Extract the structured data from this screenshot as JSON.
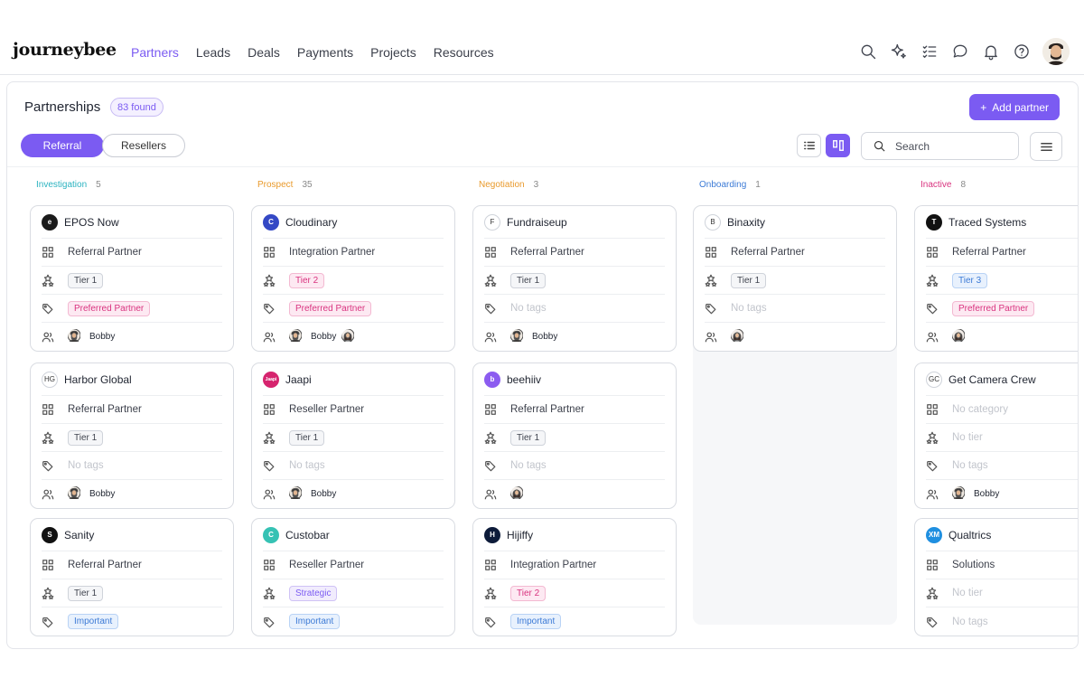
{
  "brand": {
    "name": "journeybee",
    "accent": "#7b5bf2"
  },
  "nav": {
    "items": [
      "Partners",
      "Leads",
      "Deals",
      "Payments",
      "Projects",
      "Resources"
    ],
    "active": "Partners"
  },
  "header": {
    "title": "Partnerships",
    "count_badge": "83 found",
    "add_button": "Add partner"
  },
  "segments": {
    "items": [
      "Referral",
      "Resellers"
    ],
    "active": "Referral"
  },
  "search": {
    "placeholder": "Search"
  },
  "columns": [
    {
      "name": "Investigation",
      "count": "5",
      "color": "#2bb3c0",
      "cards": [
        {
          "name": "EPOS Now",
          "logo": "e",
          "logo_bg": "#1a1a1a",
          "category": "Referral Partner",
          "tier": "Tier 1",
          "tier_style": "tier",
          "tag": "Preferred Partner",
          "tag_style": "pink",
          "people": [
            "Bobby"
          ],
          "extra_face": false
        },
        {
          "name": "Harbor Global",
          "logo": "HG",
          "logo_bg": "#ffffff",
          "category": "Referral Partner",
          "tier": "Tier 1",
          "tier_style": "tier",
          "tag": "No tags",
          "tag_style": "none",
          "people": [
            "Bobby"
          ],
          "extra_face": false
        },
        {
          "name": "Sanity",
          "logo": "S",
          "logo_bg": "#111111",
          "category": "Referral Partner",
          "tier": "Tier 1",
          "tier_style": "tier",
          "tag": "Important",
          "tag_style": "blue",
          "people": [],
          "extra_face": false
        }
      ]
    },
    {
      "name": "Prospect",
      "count": "35",
      "color": "#e99a2c",
      "cards": [
        {
          "name": "Cloudinary",
          "logo": "C",
          "logo_bg": "#3448c5",
          "category": "Integration Partner",
          "tier": "Tier 2",
          "tier_style": "pink",
          "tag": "Preferred Partner",
          "tag_style": "pink",
          "people": [
            "Bobby"
          ],
          "extra_face": true
        },
        {
          "name": "Jaapi",
          "logo": "Jaapi",
          "logo_bg": "#d6246e",
          "category": "Reseller Partner",
          "tier": "Tier 1",
          "tier_style": "tier",
          "tag": "No tags",
          "tag_style": "none",
          "people": [
            "Bobby"
          ],
          "extra_face": false
        },
        {
          "name": "Custobar",
          "logo": "C",
          "logo_bg": "#36c2b4",
          "category": "Reseller Partner",
          "tier": "Strategic",
          "tier_style": "violet",
          "tag": "Important",
          "tag_style": "blue",
          "people": [],
          "extra_face": false
        }
      ]
    },
    {
      "name": "Negotiation",
      "count": "3",
      "color": "#e99a2c",
      "cards": [
        {
          "name": "Fundraiseup",
          "logo": "F",
          "logo_bg": "#ffffff",
          "category": "Referral Partner",
          "tier": "Tier 1",
          "tier_style": "tier",
          "tag": "No tags",
          "tag_style": "none",
          "people": [
            "Bobby"
          ],
          "extra_face": false
        },
        {
          "name": "beehiiv",
          "logo": "b",
          "logo_bg": "#8c5cf0",
          "category": "Referral Partner",
          "tier": "Tier 1",
          "tier_style": "tier",
          "tag": "No tags",
          "tag_style": "none",
          "people": [],
          "extra_face": true
        },
        {
          "name": "Hijiffy",
          "logo": "H",
          "logo_bg": "#0d1b3a",
          "category": "Integration Partner",
          "tier": "Tier 2",
          "tier_style": "pink",
          "tag": "Important",
          "tag_style": "blue",
          "people": [],
          "extra_face": false
        }
      ]
    },
    {
      "name": "Onboarding",
      "count": "1",
      "color": "#3d7bd6",
      "cards": [
        {
          "name": "Binaxity",
          "logo": "B",
          "logo_bg": "#ffffff",
          "category": "Referral Partner",
          "tier": "Tier 1",
          "tier_style": "tier",
          "tag": "No tags",
          "tag_style": "none",
          "people": [],
          "extra_face": true
        }
      ]
    },
    {
      "name": "Inactive",
      "count": "8",
      "color": "#d9337f",
      "cards": [
        {
          "name": "Traced Systems",
          "logo": "T",
          "logo_bg": "#111111",
          "category": "Referral Partner",
          "tier": "Tier 3",
          "tier_style": "blue",
          "tag": "Preferred Partner",
          "tag_style": "pink",
          "people": [],
          "extra_face": true
        },
        {
          "name": "Get Camera Crew",
          "logo": "GC",
          "logo_bg": "#ffffff",
          "category": "No category",
          "tier": "No tier",
          "tier_style": "none",
          "tag": "No tags",
          "tag_style": "none",
          "people": [
            "Bobby"
          ],
          "extra_face": false
        },
        {
          "name": "Qualtrics",
          "logo": "XM",
          "logo_bg": "#1f8fe0",
          "category": "Solutions",
          "tier": "No tier",
          "tier_style": "none",
          "tag": "No tags",
          "tag_style": "none",
          "people": [],
          "extra_face": false
        }
      ]
    }
  ]
}
